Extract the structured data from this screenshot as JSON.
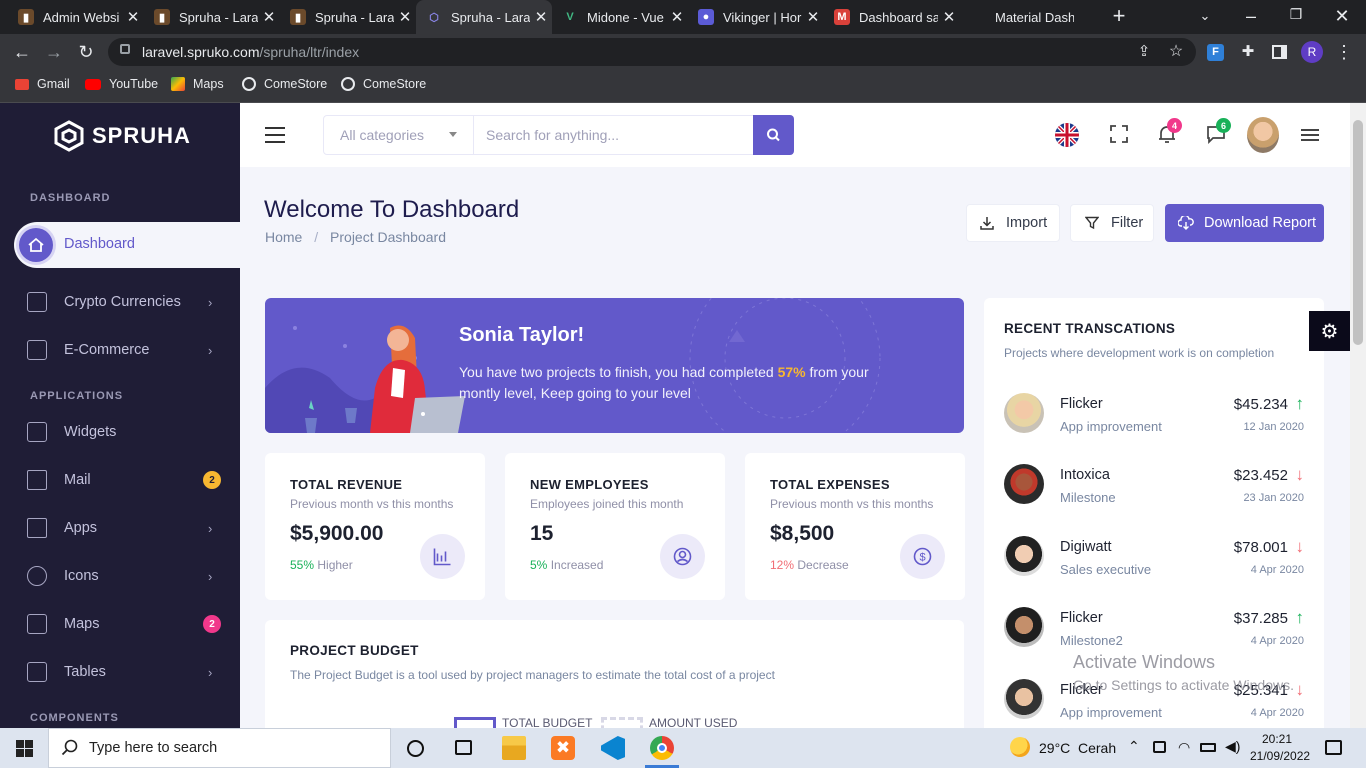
{
  "browser": {
    "tabs": [
      {
        "title": "Admin Websi",
        "fav_bg": "#6b4a2b",
        "fav_text": "▮"
      },
      {
        "title": "Spruha - Lara",
        "fav_bg": "#6b4a2b",
        "fav_text": "▮"
      },
      {
        "title": "Spruha - Lara",
        "fav_bg": "#6b4a2b",
        "fav_text": "▮"
      },
      {
        "title": "Spruha - Lara",
        "fav_bg": "transparent",
        "fav_text": "⬡"
      },
      {
        "title": "Midone - Vue",
        "fav_bg": "transparent",
        "fav_text": "V"
      },
      {
        "title": "Vikinger | Hor",
        "fav_bg": "#5b5bd6",
        "fav_text": "●"
      },
      {
        "title": "Dashboard sa",
        "fav_bg": "#d9413a",
        "fav_text": "M"
      },
      {
        "title": "Material Dash",
        "fav_bg": "transparent",
        "fav_text": ""
      }
    ],
    "url_host": "laravel.spruko.com",
    "url_path": "/spruha/ltr/index",
    "profile_initial": "R",
    "bookmarks": [
      "Gmail",
      "YouTube",
      "Maps",
      "ComeStore",
      "ComeStore"
    ]
  },
  "sidebar": {
    "brand": "SPRUHA",
    "sections": {
      "dashboard": "DASHBOARD",
      "applications": "APPLICATIONS",
      "components": "COMPONENTS"
    },
    "active": "Dashboard",
    "items": [
      {
        "label": "Crypto Currencies",
        "chevron": "›"
      },
      {
        "label": "E-Commerce",
        "chevron": "›"
      },
      {
        "label": "Widgets"
      },
      {
        "label": "Mail",
        "badge": "2"
      },
      {
        "label": "Apps",
        "chevron": "›"
      },
      {
        "label": "Icons",
        "chevron": "›"
      },
      {
        "label": "Maps",
        "badge": "2"
      },
      {
        "label": "Tables",
        "chevron": "›"
      }
    ]
  },
  "header": {
    "category": "All categories",
    "search_placeholder": "Search for anything...",
    "notif_count": "4",
    "chat_count": "6"
  },
  "page": {
    "title": "Welcome To Dashboard",
    "crumb_home": "Home",
    "crumb_sep": "/",
    "crumb_current": "Project Dashboard",
    "import": "Import",
    "filter": "Filter",
    "download": "Download Report"
  },
  "hero": {
    "name": "Sonia Taylor!",
    "text_pre": "You have two projects to finish, you had completed",
    "percent": "57%",
    "text_post": "from your montly level, Keep going to your level"
  },
  "stats": [
    {
      "title": "TOTAL REVENUE",
      "sub": "Previous month vs this months",
      "value": "$5,900.00",
      "pct": "55%",
      "pct_color": "#19b159",
      "foot": "Higher"
    },
    {
      "title": "NEW EMPLOYEES",
      "sub": "Employees joined this month",
      "value": "15",
      "pct": "5%",
      "pct_color": "#19b159",
      "foot": "Increased"
    },
    {
      "title": "TOTAL EXPENSES",
      "sub": "Previous month vs this months",
      "value": "$8,500",
      "pct": "12%",
      "pct_color": "#f16d75",
      "foot": "Decrease"
    }
  ],
  "transactions": {
    "title": "RECENT TRANSCATIONS",
    "subtitle": "Projects where development work is on completion",
    "rows": [
      {
        "name": "Flicker",
        "sub": "App improvement",
        "amount": "$45.234",
        "dir": "up",
        "date": "12 Jan 2020"
      },
      {
        "name": "Intoxica",
        "sub": "Milestone",
        "amount": "$23.452",
        "dir": "down",
        "date": "23 Jan 2020"
      },
      {
        "name": "Digiwatt",
        "sub": "Sales executive",
        "amount": "$78.001",
        "dir": "down",
        "date": "4 Apr 2020"
      },
      {
        "name": "Flicker",
        "sub": "Milestone2",
        "amount": "$37.285",
        "dir": "up",
        "date": "4 Apr 2020"
      },
      {
        "name": "Flicker",
        "sub": "App improvement",
        "amount": "$25.341",
        "dir": "down",
        "date": "4 Apr 2020"
      }
    ]
  },
  "budget": {
    "title": "PROJECT BUDGET",
    "desc": "The Project Budget is a tool used by project managers to estimate the total cost of a project",
    "legend_total": "TOTAL BUDGET",
    "legend_used": "AMOUNT USED"
  },
  "watermark": {
    "line1": "Activate Windows",
    "line2": "Go to Settings to activate Windows."
  },
  "taskbar": {
    "search": "Type here to search",
    "temp": "29°C",
    "weather": "Cerah",
    "time": "20:21",
    "date": "21/09/2022"
  },
  "colors": {
    "accent": "#6259ca",
    "sidebar": "#1f1d36",
    "orange": "#f7b731",
    "up": "#19b159",
    "down": "#f16d75",
    "badge_pink": "#f1388b"
  }
}
